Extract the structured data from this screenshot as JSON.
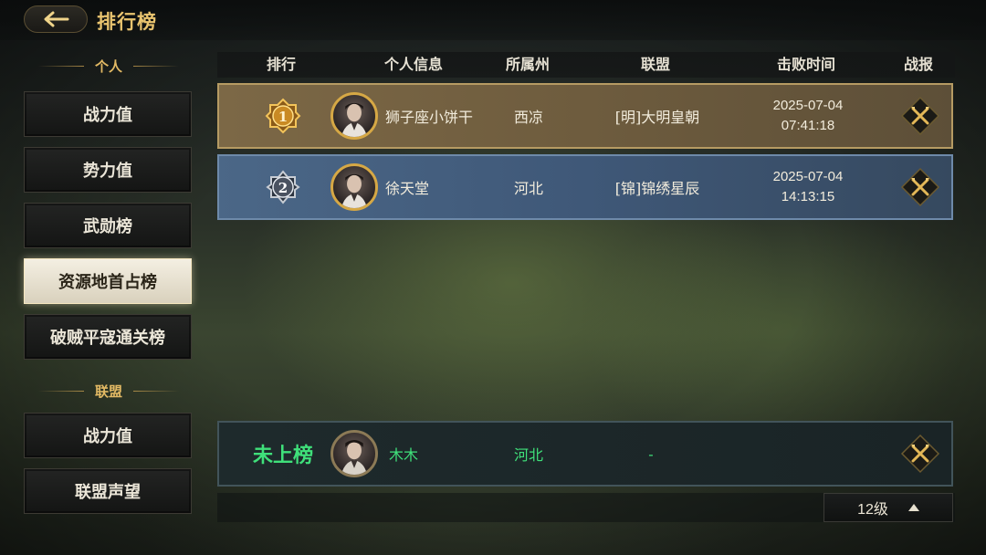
{
  "header": {
    "title": "排行榜"
  },
  "sidebar": {
    "personal_section": "个人",
    "personal_items": [
      "战力值",
      "势力值",
      "武勋榜",
      "资源地首占榜",
      "破贼平寇通关榜"
    ],
    "active_item": "资源地首占榜",
    "alliance_section": "联盟",
    "alliance_items": [
      "战力值",
      "联盟声望"
    ]
  },
  "table": {
    "columns": [
      "排行",
      "个人信息",
      "所属州",
      "联盟",
      "击败时间",
      "战报"
    ],
    "rows": [
      {
        "rank": "1",
        "name": "狮子座小饼干",
        "state": "西凉",
        "alliance": "[明]大明皇朝",
        "date": "2025-07-04",
        "time": "07:41:18"
      },
      {
        "rank": "2",
        "name": "徐天堂",
        "state": "河北",
        "alliance": "[锦]锦绣星辰",
        "date": "2025-07-04",
        "time": "14:13:15"
      }
    ],
    "my_row": {
      "rank": "未上榜",
      "name": "木木",
      "state": "河北",
      "alliance": "-"
    }
  },
  "level_selector": {
    "value": "12级"
  },
  "icons": {
    "back": "back-arrow-icon",
    "report": "crossed-swords-icon",
    "rank1": "gold-rank-badge",
    "rank2": "silver-rank-badge"
  },
  "colors": {
    "gold": "#e9c46f",
    "green": "#3fe07a",
    "rank1_bg": "#7c6846",
    "rank2_bg": "#4b6787"
  }
}
